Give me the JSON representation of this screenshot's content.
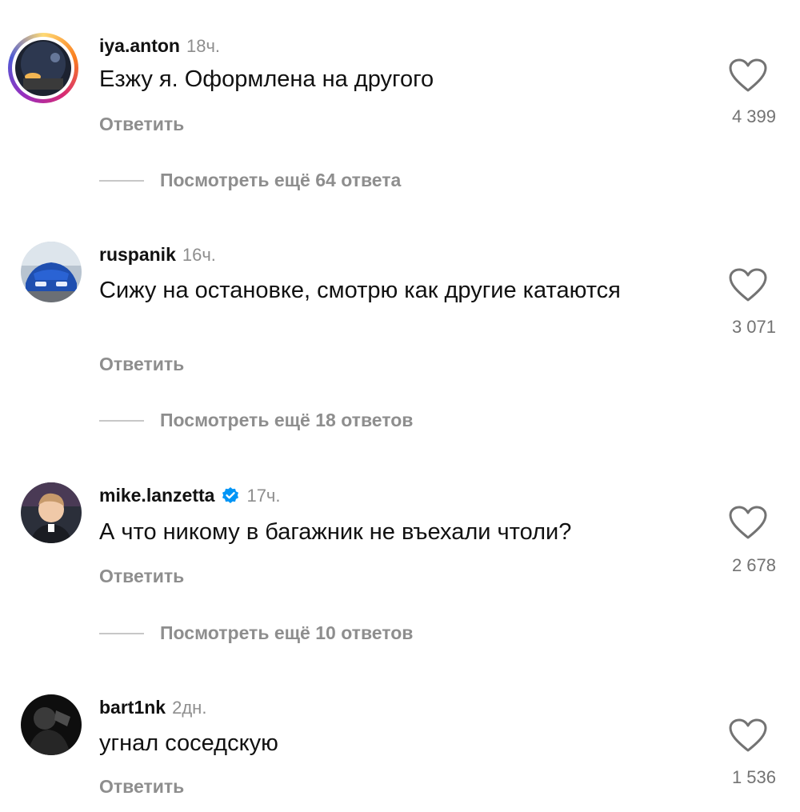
{
  "comments": [
    {
      "username": "iya.anton",
      "time": "18ч.",
      "text": "Езжу я. Оформлена на другого",
      "reply_label": "Ответить",
      "likes": "4 399",
      "more_replies": "Посмотреть ещё 64 ответа",
      "verified": false,
      "has_story": true
    },
    {
      "username": "ruspanik",
      "time": "16ч.",
      "text": "Сижу на остановке, смотрю как другие катаются",
      "reply_label": "Ответить",
      "likes": "3 071",
      "more_replies": "Посмотреть ещё 18 ответов",
      "verified": false,
      "has_story": false
    },
    {
      "username": "mike.lanzetta",
      "time": "17ч.",
      "text": "А что никому в багажник не въехали чтоли?",
      "reply_label": "Ответить",
      "likes": "2 678",
      "more_replies": "Посмотреть ещё 10 ответов",
      "verified": true,
      "has_story": false
    },
    {
      "username": "bart1nk",
      "time": "2дн.",
      "text": "угнал соседскую",
      "reply_label": "Ответить",
      "likes": "1 536",
      "verified": false,
      "has_story": false
    }
  ],
  "colors": {
    "text": "#111111",
    "muted": "#8e8e8e",
    "verified_blue": "#0095f6",
    "story_gradient": [
      "#feda75",
      "#fa7e1e",
      "#d62976",
      "#962fbf"
    ]
  },
  "icons": {
    "like": "heart-outline-icon",
    "verified": "verified-badge-icon"
  }
}
